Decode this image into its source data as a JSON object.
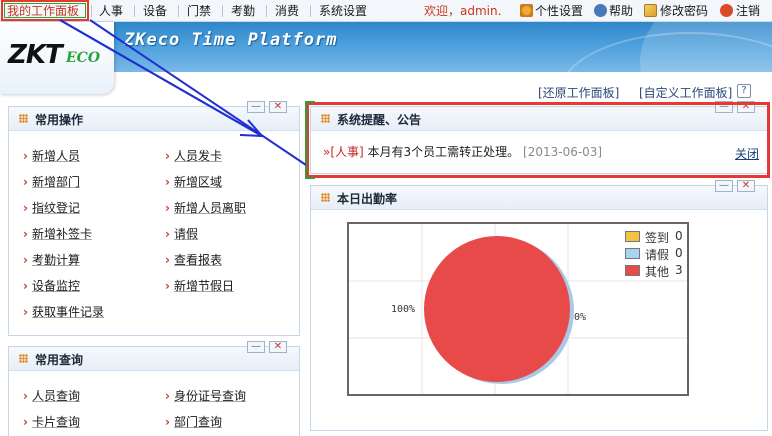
{
  "menu": {
    "items": [
      {
        "label": "我的工作面板",
        "active": true
      },
      {
        "label": "人事",
        "active": false
      },
      {
        "label": "设备",
        "active": false
      },
      {
        "label": "门禁",
        "active": false
      },
      {
        "label": "考勤",
        "active": false
      },
      {
        "label": "消费",
        "active": false
      },
      {
        "label": "系统设置",
        "active": false
      }
    ],
    "welcome": "欢迎，admin.",
    "personal_settings": "个性设置",
    "help": "帮助",
    "change_password": "修改密码",
    "logout": "注销"
  },
  "banner": {
    "logo_main": "ZKT",
    "logo_sub": "ECO",
    "title": "ZKeco Time Platform"
  },
  "toolbar": {
    "restore_panel": "[还原工作面板]",
    "custom_panel": "[自定义工作面板]",
    "help_glyph": "?"
  },
  "common_ops": {
    "title": "常用操作",
    "left": [
      "新增人员",
      "新增部门",
      "指纹登记",
      "新增补签卡",
      "考勤计算",
      "设备监控",
      "获取事件记录"
    ],
    "right": [
      "人员发卡",
      "新增区域",
      "新增人员离职",
      "请假",
      "查看报表",
      "新增节假日"
    ]
  },
  "common_query": {
    "title": "常用查询",
    "left": [
      "人员查询",
      "卡片查询"
    ],
    "right": [
      "身份证号查询",
      "部门查询"
    ]
  },
  "notice": {
    "title": "系统提醒、公告",
    "marker": "»",
    "category": "[人事]",
    "message": "本月有3个员工需转正处理。",
    "date": "[2013-06-03]",
    "close": "关闭"
  },
  "attendance": {
    "title": "本日出勤率"
  },
  "chart_data": {
    "type": "pie",
    "title": "",
    "categories": [
      "签到",
      "请假",
      "其他"
    ],
    "values": [
      0,
      0,
      3
    ],
    "colors": [
      "#f5c242",
      "#a9d3f0",
      "#e84a4a"
    ],
    "labels": [
      "100%",
      "0%"
    ]
  },
  "colors": {
    "accent": "#3a8fd0",
    "highlight_red": "#e53935",
    "highlight_green": "#2e9d3a",
    "arrow": "#1f2fd0"
  }
}
